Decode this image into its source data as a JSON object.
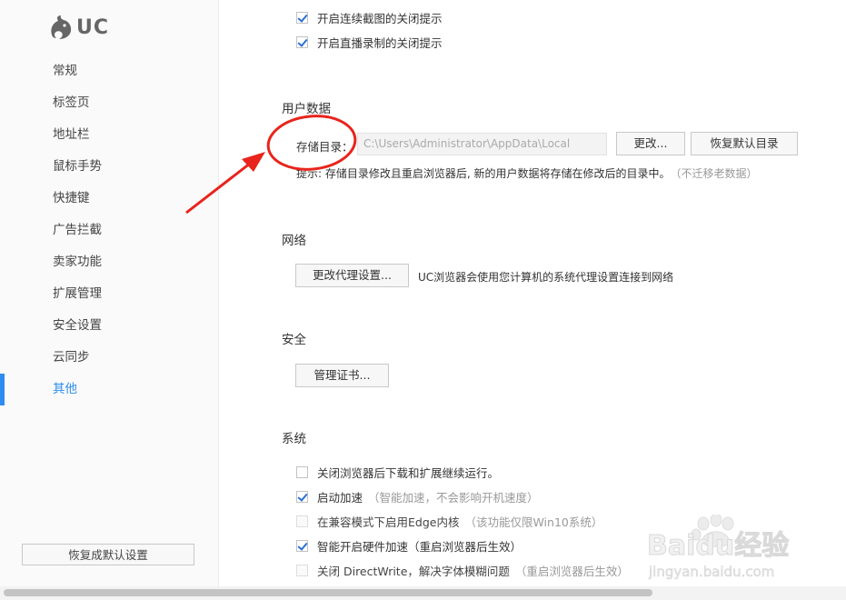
{
  "app": {
    "logo_text": "UC"
  },
  "sidebar": {
    "items": [
      {
        "label": "常规"
      },
      {
        "label": "标签页"
      },
      {
        "label": "地址栏"
      },
      {
        "label": "鼠标手势"
      },
      {
        "label": "快捷键"
      },
      {
        "label": "广告拦截"
      },
      {
        "label": "卖家功能"
      },
      {
        "label": "扩展管理"
      },
      {
        "label": "安全设置"
      },
      {
        "label": "云同步"
      },
      {
        "label": "其他",
        "active": true
      }
    ],
    "restore_defaults": "恢复成默认设置"
  },
  "screenshot_options": {
    "continuous_capture": {
      "label": "开启连续截图的关闭提示",
      "checked": true
    },
    "live_record": {
      "label": "开启直播录制的关闭提示",
      "checked": true
    }
  },
  "user_data": {
    "title": "用户数据",
    "storage_label": "存储目录：",
    "storage_path": "C:\\Users\\Administrator\\AppData\\Local",
    "change_button": "更改...",
    "restore_dir_button": "恢复默认目录",
    "hint": "提示: 存储目录修改且重启浏览器后, 新的用户数据将存储在修改后的目录中。",
    "hint_note": "（不迁移老数据）"
  },
  "network": {
    "title": "网络",
    "proxy_button": "更改代理设置...",
    "proxy_desc": "UC浏览器会使用您计算机的系统代理设置连接到网络"
  },
  "security": {
    "title": "安全",
    "cert_button": "管理证书..."
  },
  "system": {
    "title": "系统",
    "options": [
      {
        "label": "关闭浏览器后下载和扩展继续运行。",
        "note": "",
        "checked": false,
        "disabled": false
      },
      {
        "label": "启动加速",
        "note": "（智能加速，不会影响开机速度）",
        "checked": true,
        "disabled": false
      },
      {
        "label": "在兼容模式下启用Edge内核",
        "note": "（该功能仅限Win10系统）",
        "checked": false,
        "disabled": true
      },
      {
        "label": "智能开启硬件加速（重启浏览器后生效）",
        "note": "",
        "checked": true,
        "disabled": false
      },
      {
        "label": "关闭 DirectWrite，解决字体模糊问题",
        "note": "（重启浏览器后生效）",
        "checked": false,
        "disabled": true
      }
    ]
  },
  "watermark": {
    "brand": "Baidu经验",
    "url": "jingyan.baidu.com"
  },
  "colors": {
    "accent": "#2d8cf0",
    "annotation": "#e8241c"
  }
}
